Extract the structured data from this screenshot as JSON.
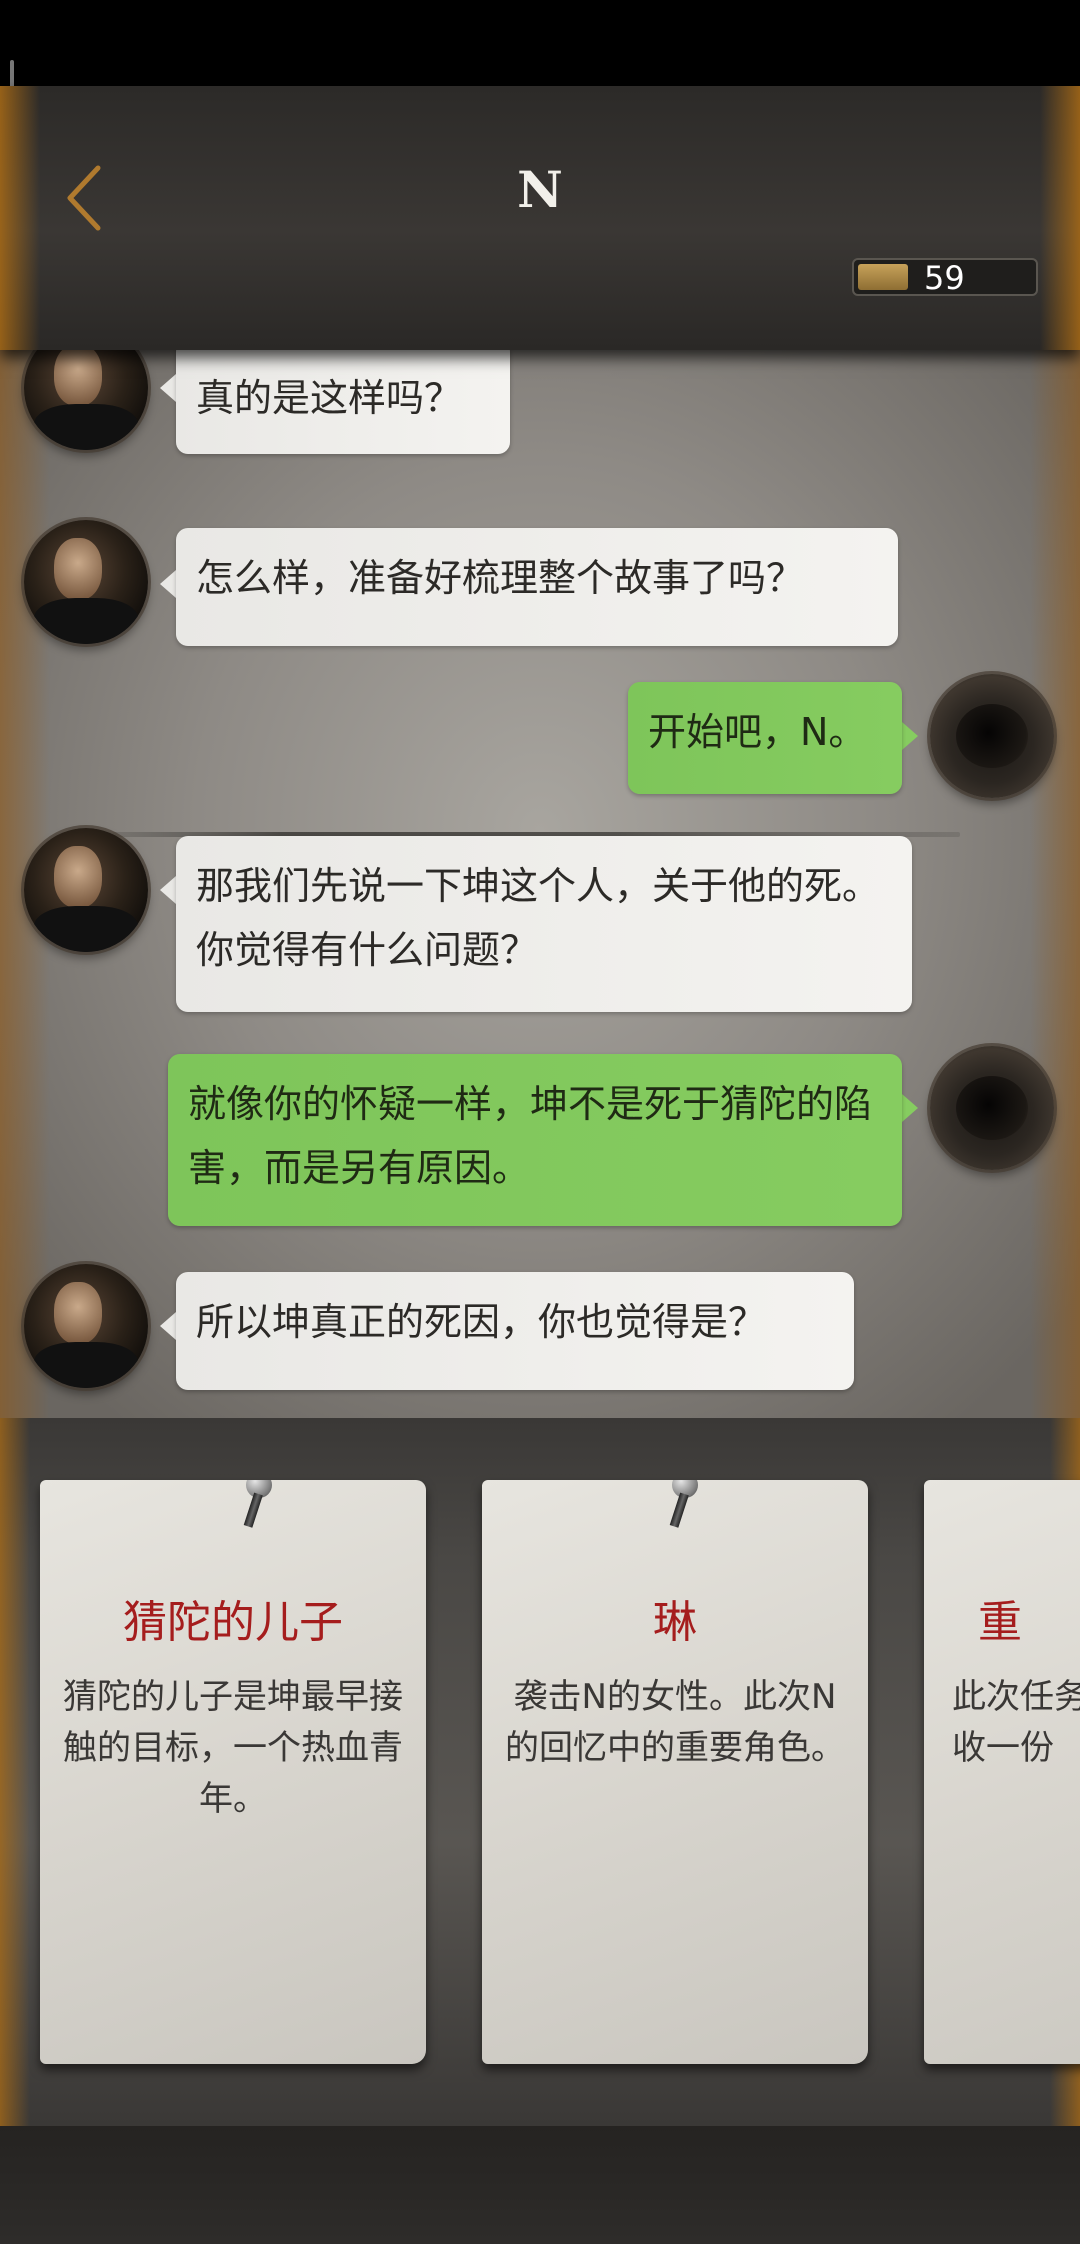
{
  "header": {
    "title": "N",
    "coin_count": "59"
  },
  "messages": [
    {
      "side": "left",
      "text": "真的是这样吗？"
    },
    {
      "side": "left",
      "text": "怎么样，准备好梳理整个故事了吗？"
    },
    {
      "side": "right",
      "text": "开始吧，N。"
    },
    {
      "side": "left",
      "text": "那我们先说一下坤这个人，关于他的死。你觉得有什么问题？"
    },
    {
      "side": "right",
      "text": "就像你的怀疑一样，坤不是死于猜陀的陷害，而是另有原因。"
    },
    {
      "side": "left",
      "text": "所以坤真正的死因，你也觉得是？"
    }
  ],
  "cards": [
    {
      "title": "猜陀的儿子",
      "desc": "猜陀的儿子是坤最早接触的目标，一个热血青年。"
    },
    {
      "title": "琳",
      "desc": "袭击N的女性。此次N的回忆中的重要角色。"
    },
    {
      "title": "重",
      "desc": "此次任务收一份"
    }
  ],
  "colors": {
    "accent_gold": "#b0702a",
    "bubble_green": "#86cc60",
    "bubble_gray": "#efeeeb",
    "card_title_red": "#a51d1d"
  }
}
